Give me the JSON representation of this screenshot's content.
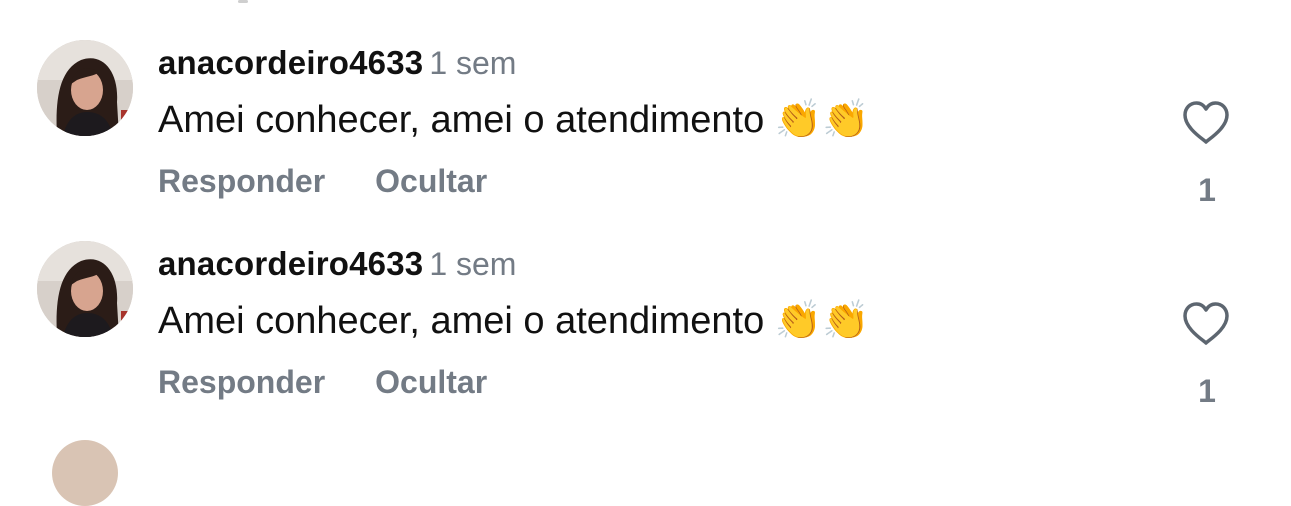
{
  "comments": [
    {
      "username": "anacordeiro4633",
      "time": "1 sem",
      "text": "Amei conhecer, amei o atendimento",
      "emoji": "👏👏",
      "reply_label": "Responder",
      "hide_label": "Ocultar",
      "like_count": "1"
    },
    {
      "username": "anacordeiro4633",
      "time": "1 sem",
      "text": "Amei conhecer, amei o atendimento",
      "emoji": "👏👏",
      "reply_label": "Responder",
      "hide_label": "Ocultar",
      "like_count": "1"
    }
  ],
  "icons": {
    "like": "heart-outline-icon"
  },
  "colors": {
    "primary_text": "#111111",
    "secondary_text": "#737b85"
  }
}
